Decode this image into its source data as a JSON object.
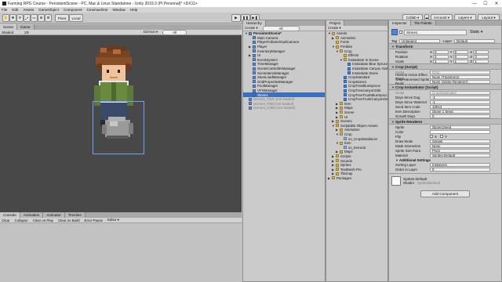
{
  "window": {
    "title": "Farming RPG Course - PersistentScene - PC, Mac & Linux Standalone - Unity 2019.3 (PI Personal)* <DX11>",
    "minimize": "—",
    "maximize": "☐",
    "close": "✕"
  },
  "menu": [
    "File",
    "Edit",
    "Assets",
    "GameObject",
    "Component",
    "Cinemachine",
    "Window",
    "Help"
  ],
  "toolbar": {
    "tools": [
      "✋",
      "✥",
      "⟳",
      "⤢",
      "▭",
      "⊕",
      "⚙"
    ],
    "pivot": "Pivot",
    "local": "Local",
    "play": "▶",
    "pause": "❚❚",
    "step": "▶❚",
    "collab": "Collab ▾",
    "account": "Account ▾",
    "layers": "Layers ▾",
    "layout": "Layout ▾"
  },
  "scene_panel": {
    "tabs": [
      "Scene",
      "Game"
    ],
    "shading": "Shaded",
    "mode": "2D",
    "gizmos": "Gizmos ▾",
    "search": "All"
  },
  "console_panel": {
    "tabs": [
      "Console",
      "Animation",
      "Animator",
      "Timeline"
    ],
    "buttons": [
      "Clear",
      "Collapse",
      "Clear on Play",
      "Clear on Build",
      "Error Pause",
      "Editor ▾"
    ]
  },
  "hierarchy": {
    "tab": "Hierarchy",
    "create": "Create ▾",
    "search": "All",
    "items": [
      {
        "label": "PersistentScene*",
        "depth": 0,
        "type": "scene",
        "bold": true,
        "expanded": true
      },
      {
        "label": "Main Camera",
        "depth": 1,
        "type": "go"
      },
      {
        "label": "PlayerFollowVirtualCamera",
        "depth": 1,
        "type": "go"
      },
      {
        "label": "Player",
        "depth": 1,
        "type": "go",
        "collapsed": true
      },
      {
        "label": "InventoryManager",
        "depth": 1,
        "type": "go"
      },
      {
        "label": "UI",
        "depth": 1,
        "type": "go",
        "collapsed": true
      },
      {
        "label": "EventSystem",
        "depth": 1,
        "type": "go"
      },
      {
        "label": "TimeManager",
        "depth": 1,
        "type": "go"
      },
      {
        "label": "SceneControllerManager",
        "depth": 1,
        "type": "go"
      },
      {
        "label": "SceneItemsManager",
        "depth": 1,
        "type": "go"
      },
      {
        "label": "SaveLoadManager",
        "depth": 1,
        "type": "go"
      },
      {
        "label": "GridPropertiesManager",
        "depth": 1,
        "type": "go"
      },
      {
        "label": "PoolManager",
        "depth": 1,
        "type": "go"
      },
      {
        "label": "VFXManager",
        "depth": 1,
        "type": "go"
      },
      {
        "label": "Stone1",
        "depth": 1,
        "type": "pref",
        "selected": true
      },
      {
        "label": "Scene1_Farm (not loaded)",
        "depth": 0,
        "type": "scene",
        "dim": true
      },
      {
        "label": "Scene2_Field (not loaded)",
        "depth": 0,
        "type": "scene",
        "dim": true
      },
      {
        "label": "Scene3_Cabin (not loaded)",
        "depth": 0,
        "type": "scene",
        "dim": true
      }
    ]
  },
  "project": {
    "tab": "Project",
    "create": "Create ▾",
    "items": [
      {
        "label": "Assets",
        "depth": 0,
        "type": "folder",
        "expanded": true
      },
      {
        "label": "Animation",
        "depth": 1,
        "type": "folder",
        "collapsed": true
      },
      {
        "label": "Fonts",
        "depth": 1,
        "type": "folder"
      },
      {
        "label": "Prefabs",
        "depth": 1,
        "type": "folder",
        "expanded": true
      },
      {
        "label": "Crop",
        "depth": 2,
        "type": "folder",
        "expanded": true
      },
      {
        "label": "Effects",
        "depth": 3,
        "type": "folder"
      },
      {
        "label": "Instantiate In Scene",
        "depth": 3,
        "type": "folder",
        "expanded": true
      },
      {
        "label": "Instantiate Blue Spruce",
        "depth": 4,
        "type": "pref"
      },
      {
        "label": "Instantiate Canyon Oak",
        "depth": 4,
        "type": "pref"
      },
      {
        "label": "Instantiate Stone",
        "depth": 4,
        "type": "pref"
      },
      {
        "label": "CropStandard",
        "depth": 3,
        "type": "pref"
      },
      {
        "label": "CropStone1",
        "depth": 3,
        "type": "pref"
      },
      {
        "label": "CropTreeBlueSpruce",
        "depth": 3,
        "type": "pref"
      },
      {
        "label": "CropTreeCanyonOak",
        "depth": 3,
        "type": "pref"
      },
      {
        "label": "CropTreeTrunkBlueSpruce",
        "depth": 3,
        "type": "pref"
      },
      {
        "label": "CropTreeTrunkCanyonOak",
        "depth": 3,
        "type": "pref"
      },
      {
        "label": "Item",
        "depth": 2,
        "type": "folder",
        "collapsed": true
      },
      {
        "label": "Maps",
        "depth": 2,
        "type": "folder",
        "collapsed": true
      },
      {
        "label": "Scene",
        "depth": 2,
        "type": "folder",
        "collapsed": true
      },
      {
        "label": "UI",
        "depth": 2,
        "type": "folder",
        "collapsed": true
      },
      {
        "label": "Scenes",
        "depth": 1,
        "type": "folder",
        "collapsed": true
      },
      {
        "label": "Scriptable Object Assets",
        "depth": 1,
        "type": "folder",
        "expanded": true
      },
      {
        "label": "Animation",
        "depth": 2,
        "type": "folder",
        "collapsed": true
      },
      {
        "label": "Crop",
        "depth": 2,
        "type": "folder",
        "expanded": true
      },
      {
        "label": "so_CropDetailsList",
        "depth": 3,
        "type": "asset"
      },
      {
        "label": "Item",
        "depth": 2,
        "type": "folder",
        "expanded": true
      },
      {
        "label": "so_ItemList",
        "depth": 3,
        "type": "asset"
      },
      {
        "label": "Maps",
        "depth": 2,
        "type": "folder",
        "collapsed": true
      },
      {
        "label": "Scripts",
        "depth": 1,
        "type": "folder",
        "collapsed": true
      },
      {
        "label": "Sounds",
        "depth": 1,
        "type": "folder",
        "collapsed": true
      },
      {
        "label": "Sprites",
        "depth": 1,
        "type": "folder",
        "collapsed": true
      },
      {
        "label": "TextMesh Pro",
        "depth": 1,
        "type": "folder",
        "collapsed": true
      },
      {
        "label": "Tilemap",
        "depth": 1,
        "type": "folder",
        "collapsed": true
      },
      {
        "label": "Packages",
        "depth": 0,
        "type": "folder",
        "collapsed": true
      }
    ]
  },
  "inspector": {
    "tabs": [
      "Inspector",
      "Tile Palette"
    ],
    "object_name": "Stone1",
    "static": "Static ▾",
    "tag_label": "Tag",
    "tag": "Untagged",
    "layer_label": "Layer",
    "layer": "Default",
    "transform": {
      "title": "Transform",
      "position": {
        "label": "Position",
        "x": "0",
        "y": "0",
        "z": "0"
      },
      "rotation": {
        "label": "Rotation",
        "x": "0",
        "y": "0",
        "z": "0"
      },
      "scale": {
        "label": "Scale",
        "x": "1",
        "y": "1",
        "z": "1"
      }
    },
    "crop": {
      "title": "Crop (Script)",
      "script_label": "Script",
      "script": "Crop",
      "harvest_effect_label": "Harvest Action Effect Trans",
      "harvest_effect": "None (Transform)",
      "harvested_sprite_label": "Crop Harvested Sprite Rend",
      "harvested_sprite": "None (Sprite Renderer)"
    },
    "crop_inst": {
      "title": "Crop Instantiator (Script)",
      "script_label": "Script",
      "script": "CropInstantiator",
      "days_since_dug_label": "Days Since Dug",
      "days_since_dug": "-1",
      "days_since_watered_label": "Days Since Watered",
      "days_since_watered": "-1",
      "seed_item_code_label": "Seed Item Code",
      "seed_item_code": "10014",
      "item_description_label": "Item Description",
      "item_description": "Stone 1 Seed",
      "growth_days_label": "Growth Days",
      "growth_days": "0"
    },
    "sprite_renderer": {
      "title": "Sprite Renderer",
      "sprite_label": "Sprite",
      "sprite": "Stone1Seed",
      "color_label": "Color",
      "flip_label": "Flip",
      "flip_x": "X",
      "flip_y": "Y",
      "draw_mode_label": "Draw Mode",
      "draw_mode": "Simple",
      "mask_label": "Mask Interaction",
      "mask": "None",
      "sort_point_label": "Sprite Sort Point",
      "sort_point": "Pivot",
      "material_label": "Material",
      "material": "Sprites-Default",
      "additional_label": "Additional Settings",
      "sorting_layer_label": "Sorting Layer",
      "sorting_layer": "Instances",
      "order_label": "Order in Layer",
      "order": "0"
    },
    "material_preview": {
      "name": "Sprites-Default",
      "shader_label": "Shader",
      "shader": "Sprites/Default"
    },
    "add_component": "Add Component"
  }
}
